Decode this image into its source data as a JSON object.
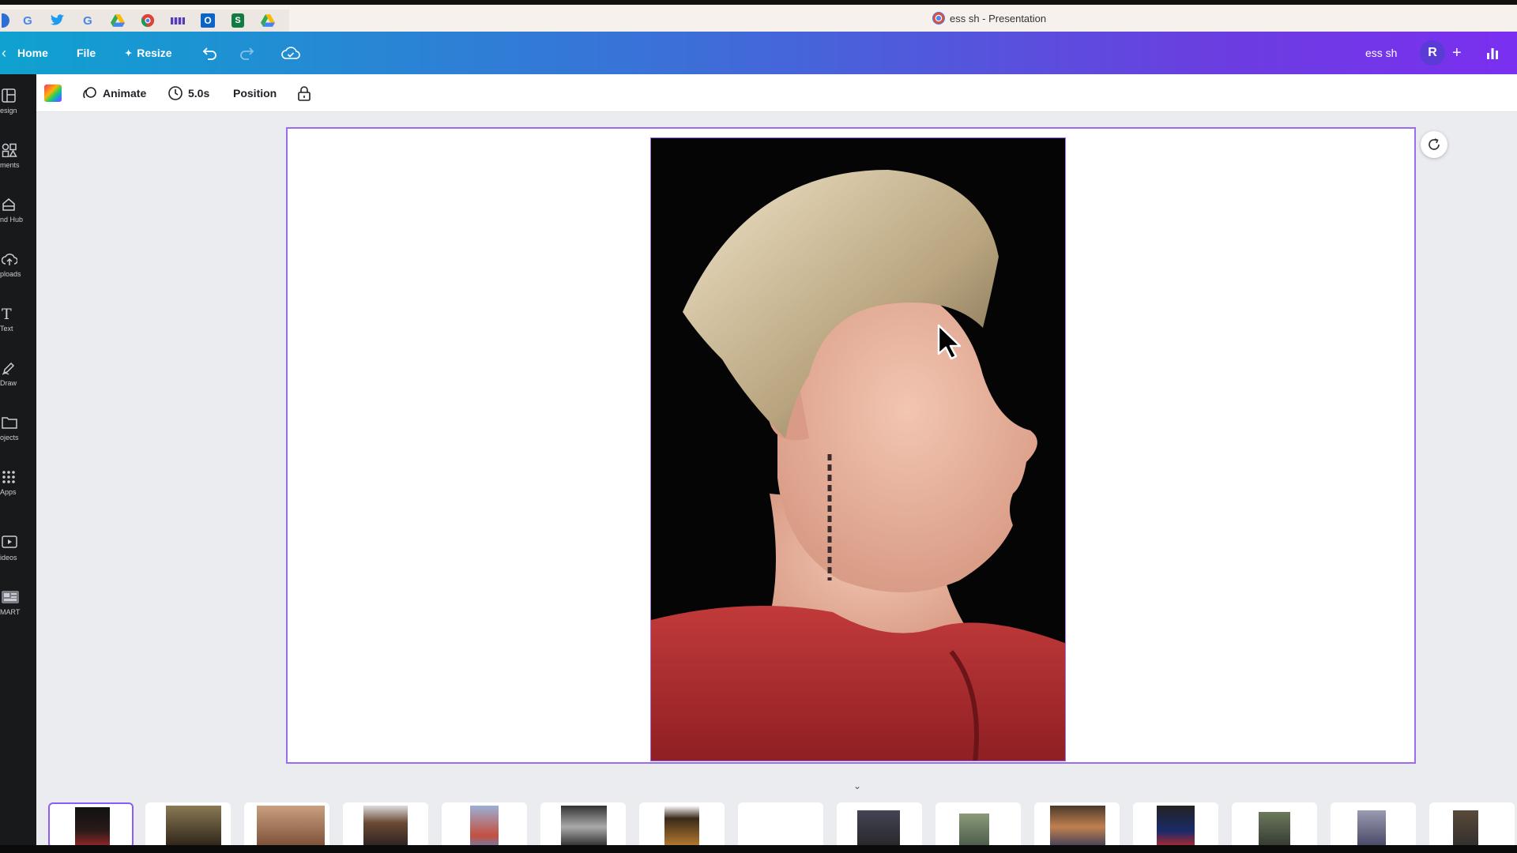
{
  "browser": {
    "window_title": "ess sh - Presentation",
    "bookmark_icons": [
      "google-icon",
      "twitter-icon",
      "google-icon",
      "drive-icon",
      "chrome-extension-icon",
      "bookmark-icon",
      "outlook-icon",
      "sheets-icon",
      "drive-icon"
    ]
  },
  "topbar": {
    "home_label": "Home",
    "file_label": "File",
    "resize_label": "Resize",
    "doc_name": "ess sh",
    "avatar_initial": "R",
    "add_label": "+"
  },
  "sidebar": {
    "items": [
      {
        "label": "esign",
        "icon": "design-icon"
      },
      {
        "label": "ments",
        "icon": "elements-icon"
      },
      {
        "label": "nd Hub",
        "icon": "brand-hub-icon"
      },
      {
        "label": "ploads",
        "icon": "uploads-icon"
      },
      {
        "label": "Text",
        "icon": "text-icon"
      },
      {
        "label": "Draw",
        "icon": "draw-icon"
      },
      {
        "label": "ojects",
        "icon": "projects-icon"
      },
      {
        "label": "Apps",
        "icon": "apps-icon"
      },
      {
        "label": "ideos",
        "icon": "videos-icon"
      },
      {
        "label": "MART",
        "icon": "smart-icon"
      }
    ]
  },
  "toolbar": {
    "animate_label": "Animate",
    "duration_label": "5.0s",
    "position_label": "Position"
  },
  "filmstrip": {
    "active_index": 0,
    "thumb_count": 15
  },
  "colors": {
    "accent": "#8b5cf6",
    "topbar_start": "#0fa2d0",
    "topbar_end": "#7b2ff0",
    "sidebar_bg": "#18191b"
  }
}
